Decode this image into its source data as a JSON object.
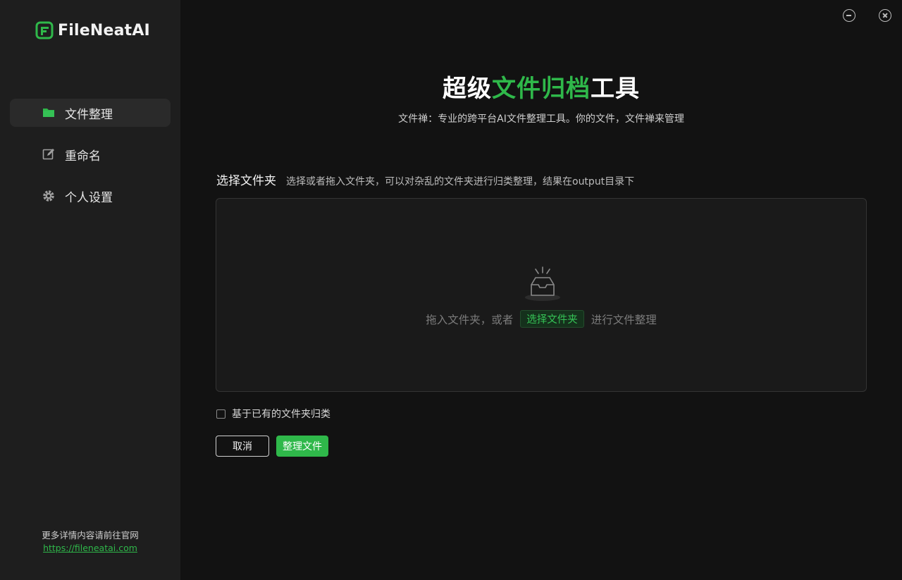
{
  "app": {
    "name": "FileNeatAI",
    "brand_color": "#2fb84a"
  },
  "sidebar": {
    "items": [
      {
        "label": "文件整理",
        "icon": "folder-icon",
        "active": true
      },
      {
        "label": "重命名",
        "icon": "edit-icon",
        "active": false
      },
      {
        "label": "个人设置",
        "icon": "gear-icon",
        "active": false
      }
    ],
    "footer": {
      "text": "更多详情内容请前往官网",
      "link": "https://fileneatai.com"
    }
  },
  "window_controls": {
    "minimize_icon": "minimize-icon",
    "close_icon": "close-icon"
  },
  "hero": {
    "title_part1": "超级",
    "title_accent": "文件归档",
    "title_part2": "工具",
    "subtitle": "文件禅：专业的跨平台AI文件整理工具。你的文件，文件禅来管理"
  },
  "section": {
    "title": "选择文件夹",
    "description": "选择或者拖入文件夹，可以对杂乱的文件夹进行归类整理，结果在output目录下"
  },
  "dropzone": {
    "icon": "inbox-icon",
    "text_before": "拖入文件夹，或者",
    "link_label": "选择文件夹",
    "text_after": "进行文件整理"
  },
  "option": {
    "label": "基于已有的文件夹归类",
    "checked": false
  },
  "buttons": {
    "cancel": "取消",
    "primary": "整理文件"
  }
}
